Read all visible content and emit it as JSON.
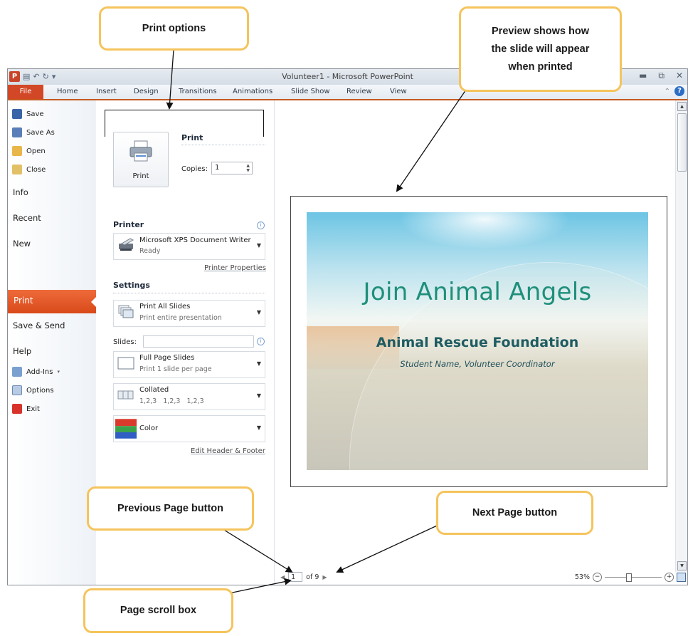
{
  "window": {
    "title": "Volunteer1 - Microsoft PowerPoint",
    "app_icon": "P",
    "qat_icons": [
      "save-icon",
      "undo-icon",
      "redo-icon",
      "customize-icon"
    ],
    "controls": [
      "minimize-icon",
      "restore-icon",
      "close-icon"
    ]
  },
  "ribbon": {
    "file": "File",
    "tabs": [
      "Home",
      "Insert",
      "Design",
      "Transitions",
      "Animations",
      "Slide Show",
      "Review",
      "View"
    ]
  },
  "nav": {
    "save": "Save",
    "save_as": "Save As",
    "open": "Open",
    "close": "Close",
    "info": "Info",
    "recent": "Recent",
    "new": "New",
    "print": "Print",
    "save_send": "Save & Send",
    "help": "Help",
    "addins": "Add-Ins",
    "options": "Options",
    "exit": "Exit"
  },
  "print_panel": {
    "print_heading": "Print",
    "print_button": "Print",
    "copies_label": "Copies:",
    "copies_value": "1",
    "printer_heading": "Printer",
    "printer_name": "Microsoft XPS Document Writer",
    "printer_status": "Ready",
    "printer_properties": "Printer Properties",
    "settings_heading": "Settings",
    "range_main": "Print All Slides",
    "range_sub": "Print entire presentation",
    "slides_label": "Slides:",
    "slides_value": "",
    "layout_main": "Full Page Slides",
    "layout_sub": "Print 1 slide per page",
    "collate_main": "Collated",
    "collate_sub": "1,2,3   1,2,3   1,2,3",
    "color_main": "Color",
    "edit_header_footer": "Edit Header & Footer"
  },
  "preview": {
    "slide_title": "Join Animal Angels",
    "slide_subtitle": "Animal Rescue Foundation",
    "slide_byline": "Student Name, Volunteer Coordinator",
    "page_current": "1",
    "page_of": "of 9",
    "zoom_level": "53%"
  },
  "callouts": {
    "print_options": "Print options",
    "preview_line1": "Preview shows how",
    "preview_line2": "the slide will appear",
    "preview_line3": "when printed",
    "previous_page": "Previous Page button",
    "next_page": "Next Page button",
    "page_scroll": "Page scroll box"
  },
  "colors": {
    "file_tab": "#d24726",
    "print_nav": "#e55b2a",
    "callout_border": "#f5c45c",
    "slide_title": "#1e8f7b"
  }
}
